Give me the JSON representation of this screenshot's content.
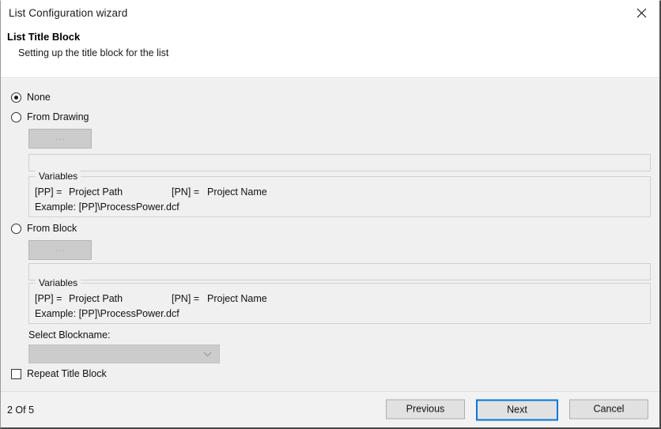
{
  "window": {
    "title": "List Configuration wizard",
    "close_icon": "close-x-icon"
  },
  "header": {
    "heading": "List Title Block",
    "subheading": "Setting up the title block for the list"
  },
  "options": {
    "none": {
      "label": "None",
      "selected": true
    },
    "from_drawing": {
      "label": "From Drawing",
      "selected": false
    },
    "from_block": {
      "label": "From Block",
      "selected": false
    }
  },
  "drawing_section": {
    "browse_label": "...",
    "path_value": "",
    "variables": {
      "legend": "Variables",
      "pp_key": "[PP] =",
      "pp_value": "Project Path",
      "pn_key": "[PN] =",
      "pn_value": "Project Name",
      "example": "Example: [PP]\\ProcessPower.dcf"
    }
  },
  "block_section": {
    "browse_label": "...",
    "path_value": "",
    "variables": {
      "legend": "Variables",
      "pp_key": "[PP] =",
      "pp_value": "Project Path",
      "pn_key": "[PN] =",
      "pn_value": "Project Name",
      "example": "Example: [PP]\\ProcessPower.dcf"
    },
    "blockname_label": "Select Blockname:",
    "blockname_value": "",
    "blockname_chevron": "chevron-down-icon"
  },
  "repeat_title_block": {
    "label": "Repeat Title Block",
    "checked": false
  },
  "footer": {
    "page_indicator": "2 Of 5",
    "previous_label": "Previous",
    "next_label": "Next",
    "cancel_label": "Cancel",
    "focus_color": "#0078d7"
  }
}
